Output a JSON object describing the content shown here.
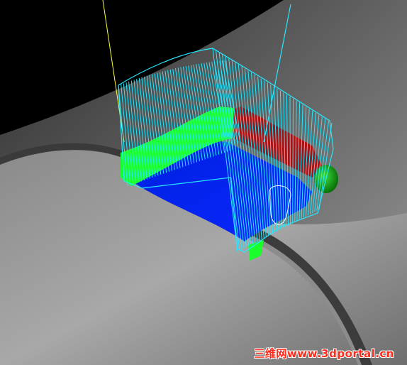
{
  "watermark": {
    "text": "三维网www.3dportal.cn"
  },
  "colors": {
    "background": "#000000",
    "surface_light": "#b9b9b9",
    "surface_dark": "#5a5a5a",
    "wall": "#0026ff",
    "green_band": "#1aff2a",
    "red_band": "#b01010",
    "toolpath": "#27e7ff",
    "tool_axis_yellow": "#ffff40",
    "tool_holder": "#00b000"
  },
  "scene": {
    "description_icons": [
      "part-surface",
      "pocket-wall",
      "toolpath-lines",
      "tool-axis-lines",
      "tool-holder"
    ]
  }
}
